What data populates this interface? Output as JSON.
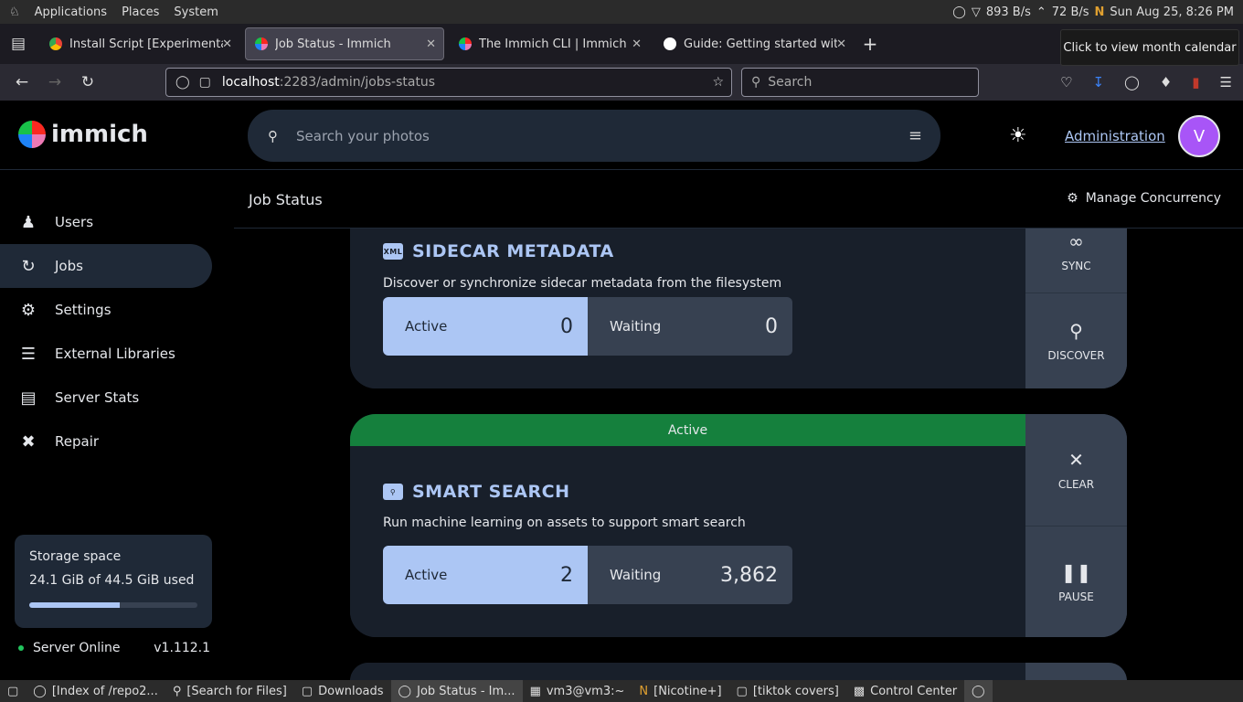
{
  "system_bar": {
    "menus": [
      "Applications",
      "Places",
      "System"
    ],
    "net_down": "893 B/s",
    "net_up": "72 B/s",
    "clock": "Sun Aug 25,  8:26 PM",
    "tooltip": "Click to view month calendar"
  },
  "tabs": [
    {
      "label": "Install Script [Experimental]",
      "active": false,
      "favicon_color": "#4285f4"
    },
    {
      "label": "Job Status - Immich",
      "active": true,
      "favicon_color": "#fa2921"
    },
    {
      "label": "The Immich CLI | Immich",
      "active": false,
      "favicon_color": "#fa2921"
    },
    {
      "label": "Guide: Getting started with",
      "active": false,
      "favicon_color": "#ffffff"
    }
  ],
  "url": {
    "host": "localhost",
    "rest": ":2283/admin/jobs-status"
  },
  "browser_search": {
    "placeholder": "Search"
  },
  "app": {
    "name": "immich",
    "search_placeholder": "Search your photos",
    "admin_link": "Administration",
    "avatar_initial": "V",
    "accent_color": "#acc6f4"
  },
  "sidebar": {
    "items": [
      {
        "label": "Users",
        "icon": "users-icon",
        "active": false
      },
      {
        "label": "Jobs",
        "icon": "sync-icon",
        "active": true
      },
      {
        "label": "Settings",
        "icon": "gear-icon",
        "active": false
      },
      {
        "label": "External Libraries",
        "icon": "library-icon",
        "active": false
      },
      {
        "label": "Server Stats",
        "icon": "server-icon",
        "active": false
      },
      {
        "label": "Repair",
        "icon": "tools-icon",
        "active": false
      }
    ],
    "storage": {
      "title": "Storage space",
      "usage": "24.1 GiB of 44.5 GiB used",
      "used_fraction": 0.54
    },
    "server_status": "Server Online",
    "version": "v1.112.1"
  },
  "page": {
    "title": "Job Status",
    "concurrency_label": "Manage Concurrency"
  },
  "jobs": [
    {
      "title": "SIDECAR METADATA",
      "description": "Discover or synchronize sidecar metadata from the filesystem",
      "active_label": "Active",
      "active_count": "0",
      "waiting_label": "Waiting",
      "waiting_count": "0",
      "icon_text": "XML",
      "buttons": [
        "SYNC",
        "DISCOVER"
      ]
    },
    {
      "status": "Active",
      "title": "SMART SEARCH",
      "description": "Run machine learning on assets to support smart search",
      "active_label": "Active",
      "active_count": "2",
      "waiting_label": "Waiting",
      "waiting_count": "3,862",
      "buttons": [
        "CLEAR",
        "PAUSE"
      ]
    }
  ],
  "taskbar": [
    {
      "label": "[Index of /repo2...",
      "active": false
    },
    {
      "label": "[Search for Files]",
      "active": false
    },
    {
      "label": "Downloads",
      "active": false
    },
    {
      "label": "Job Status - Im...",
      "active": true
    },
    {
      "label": "vm3@vm3:~",
      "active": false
    },
    {
      "label": "[Nicotine+]",
      "active": false
    },
    {
      "label": "[tiktok covers]",
      "active": false
    },
    {
      "label": "Control Center",
      "active": false
    }
  ]
}
